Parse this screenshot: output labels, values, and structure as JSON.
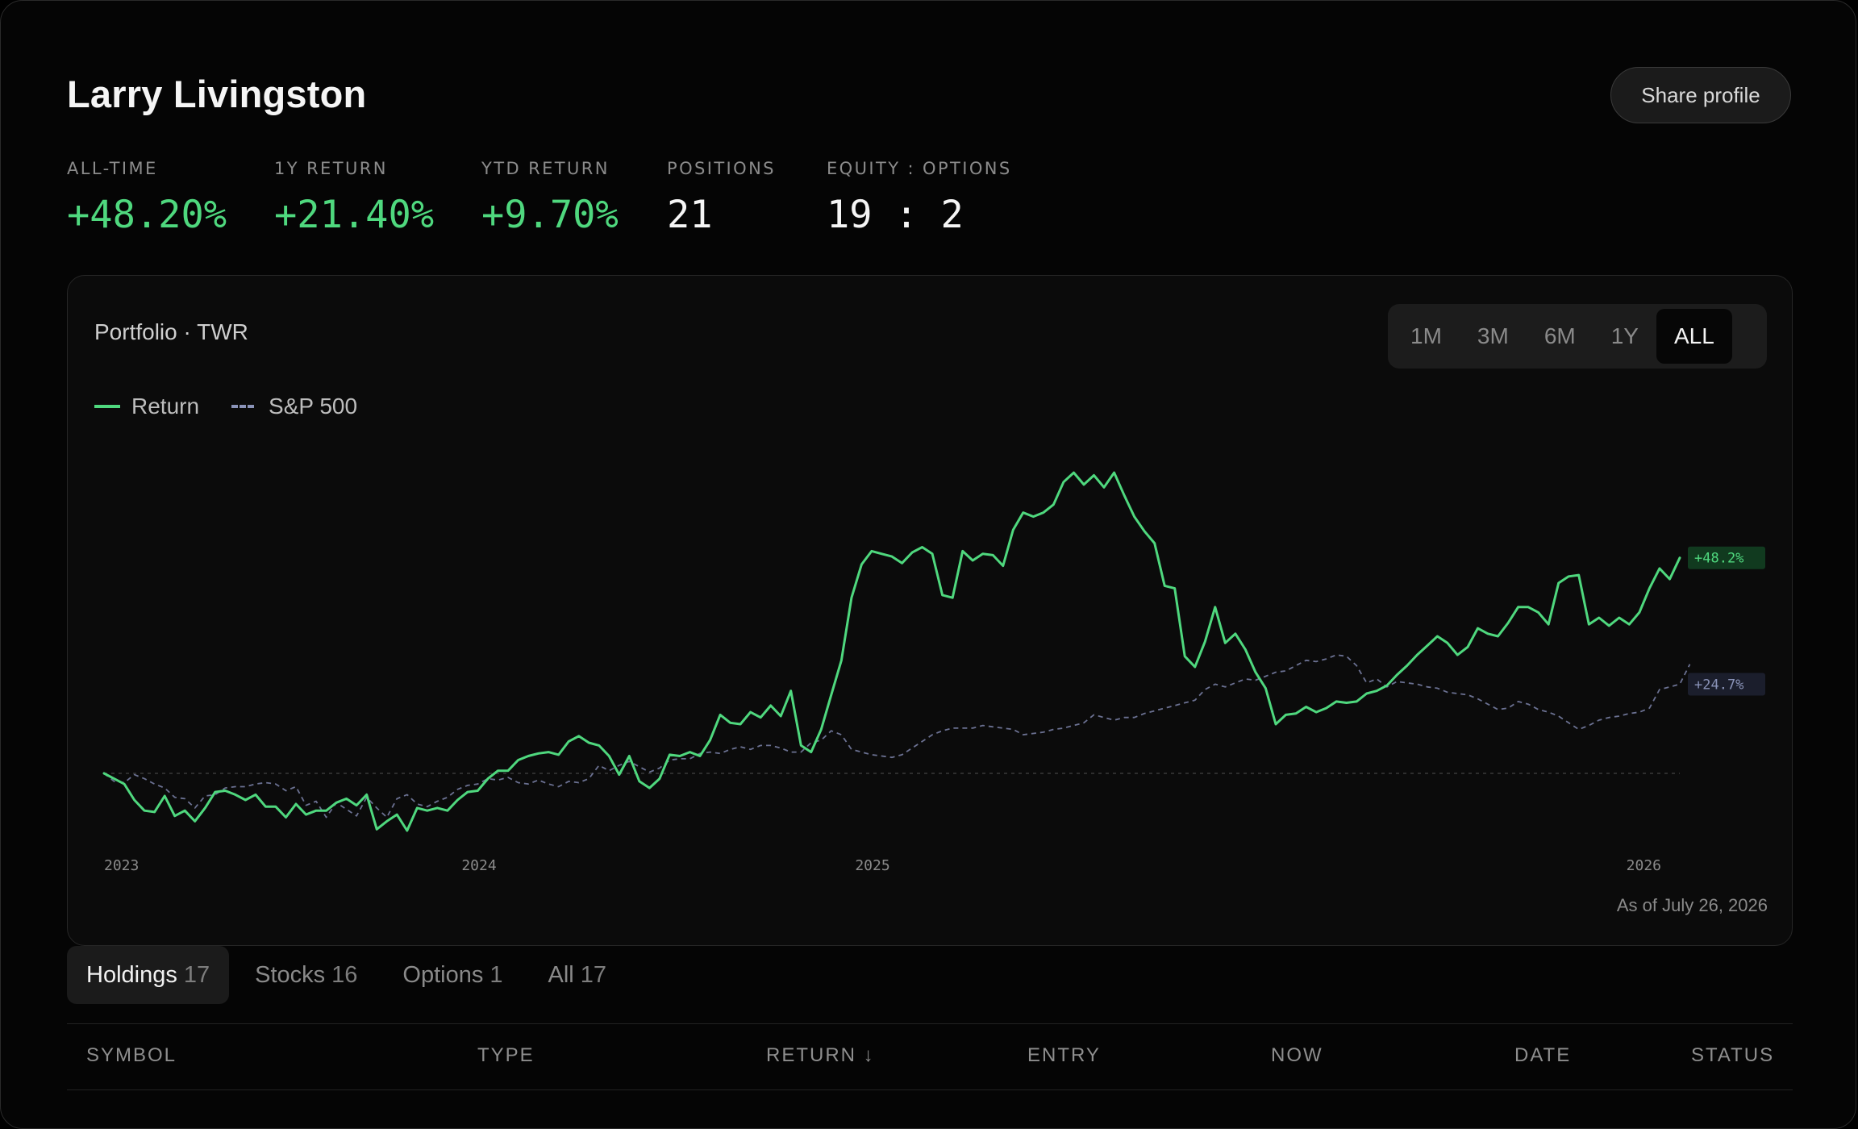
{
  "profile": {
    "name": "Larry Livingston",
    "share_label": "Share profile"
  },
  "stats": [
    {
      "label": "ALL-TIME",
      "value": "+48.20%",
      "tone": "positive"
    },
    {
      "label": "1Y RETURN",
      "value": "+21.40%",
      "tone": "positive"
    },
    {
      "label": "YTD RETURN",
      "value": "+9.70%",
      "tone": "positive"
    },
    {
      "label": "POSITIONS",
      "value": "21",
      "tone": "neutral"
    },
    {
      "label": "EQUITY : OPTIONS",
      "value": "19 : 2",
      "tone": "neutral"
    }
  ],
  "chart": {
    "title": "Portfolio · TWR",
    "ranges": [
      "1M",
      "3M",
      "6M",
      "1Y",
      "ALL"
    ],
    "active_range": "ALL",
    "as_of": "As of July 26, 2026"
  },
  "colors": {
    "positive": "#4fd87e",
    "benchmark": "#8a93b8",
    "background": "#050505",
    "card": "#0b0b0b"
  },
  "chart_data": {
    "type": "line",
    "x_ticks": [
      "2023",
      "2024",
      "2025",
      "2026"
    ],
    "ylim": [
      -5,
      35
    ],
    "baseline": 0,
    "grid": false,
    "legend_placement": "top-left",
    "series": [
      {
        "name": "Return",
        "color": "#4fd87e",
        "end_label": "+48.2%",
        "values": [
          0,
          -0.4,
          -0.8,
          -2,
          -2.8,
          -2.9,
          -1.7,
          -3.2,
          -2.8,
          -3.6,
          -2.6,
          -1.4,
          -1.3,
          -1.6,
          -2,
          -1.6,
          -2.5,
          -2.5,
          -3.3,
          -2.3,
          -3.1,
          -2.8,
          -2.8,
          -2.2,
          -1.9,
          -2.4,
          -1.6,
          -4.2,
          -3.6,
          -3.1,
          -4.3,
          -2.6,
          -2.8,
          -2.6,
          -2.8,
          -2,
          -1.4,
          -1.3,
          -0.4,
          0.2,
          0.2,
          1,
          1.3,
          1.5,
          1.6,
          1.4,
          2.4,
          2.8,
          2.3,
          2.1,
          1.3,
          -0.1,
          1.3,
          -0.6,
          -1.1,
          -0.4,
          1.4,
          1.3,
          1.6,
          1.3,
          2.5,
          4.4,
          3.8,
          3.7,
          4.6,
          4.2,
          5.1,
          4.3,
          6.2,
          2.1,
          1.6,
          3.3,
          5.9,
          8.5,
          13.2,
          15.7,
          16.7,
          16.5,
          16.3,
          15.8,
          16.6,
          17,
          16.5,
          13.4,
          13.2,
          16.7,
          16,
          16.5,
          16.4,
          15.6,
          18.3,
          19.6,
          19.3,
          19.6,
          20.2,
          21.9,
          22.6,
          21.7,
          22.4,
          21.5,
          22.6,
          20.9,
          19.3,
          18.2,
          17.3,
          14.1,
          13.9,
          8.8,
          8,
          9.9,
          12.5,
          9.8,
          10.5,
          9.3,
          7.6,
          6.4,
          3.7,
          4.4,
          4.5,
          5,
          4.6,
          4.9,
          5.4,
          5.3,
          5.4,
          6,
          6.2,
          6.6,
          7.4,
          8.1,
          8.9,
          9.6,
          10.3,
          9.8,
          8.9,
          9.5,
          10.9,
          10.5,
          10.3,
          11.3,
          12.5,
          12.5,
          12.1,
          11.2,
          14.3,
          14.8,
          14.9,
          11.2,
          11.7,
          11.1,
          11.7,
          11.2,
          12.1,
          13.9,
          15.4,
          14.6,
          16.2
        ]
      },
      {
        "name": "S&P 500",
        "color": "#8a93b8",
        "end_label": "+24.7%",
        "values": [
          0,
          -0.6,
          -0.7,
          -0.1,
          -0.4,
          -0.8,
          -1.1,
          -1.8,
          -1.9,
          -2.6,
          -1.7,
          -1.6,
          -1.1,
          -1,
          -1,
          -0.8,
          -0.7,
          -0.8,
          -1.3,
          -1,
          -2.4,
          -2.1,
          -3.3,
          -2.2,
          -2.7,
          -3.2,
          -1.8,
          -2.6,
          -3.3,
          -1.9,
          -1.6,
          -2.3,
          -2.5,
          -2.1,
          -1.8,
          -1.2,
          -0.9,
          -0.8,
          -0.4,
          -0.5,
          -0.3,
          -0.7,
          -0.8,
          -0.5,
          -0.8,
          -1,
          -0.6,
          -0.7,
          -0.4,
          0.6,
          0.2,
          0.6,
          0.9,
          0.5,
          0.1,
          0.4,
          1,
          1.1,
          1.1,
          1.5,
          1.6,
          1.5,
          1.8,
          2,
          1.8,
          2.1,
          2.1,
          1.9,
          1.6,
          1.6,
          2.3,
          2.5,
          3.2,
          2.9,
          1.8,
          1.6,
          1.4,
          1.3,
          1.2,
          1.4,
          1.9,
          2.4,
          2.9,
          3.2,
          3.4,
          3.4,
          3.4,
          3.6,
          3.5,
          3.4,
          3.3,
          2.9,
          3,
          3.1,
          3.3,
          3.4,
          3.6,
          3.8,
          4.4,
          4.2,
          4,
          4.2,
          4.2,
          4.5,
          4.7,
          4.9,
          5.1,
          5.3,
          5.5,
          6.3,
          6.7,
          6.5,
          6.8,
          7.1,
          7,
          7.3,
          7.6,
          7.7,
          8.1,
          8.5,
          8.4,
          8.6,
          8.9,
          8.8,
          8.1,
          6.8,
          7.1,
          6.5,
          6.9,
          6.8,
          6.7,
          6.5,
          6.4,
          6.1,
          6,
          5.9,
          5.6,
          5.2,
          4.8,
          4.9,
          5.4,
          5.2,
          4.8,
          4.6,
          4.3,
          3.8,
          3.3,
          3.6,
          4,
          4.2,
          4.3,
          4.5,
          4.6,
          4.9,
          6.3,
          6.5,
          6.7,
          8.2
        ]
      }
    ]
  },
  "tabs": [
    {
      "label": "Holdings",
      "count": "17",
      "active": true
    },
    {
      "label": "Stocks",
      "count": "16",
      "active": false
    },
    {
      "label": "Options",
      "count": "1",
      "active": false
    },
    {
      "label": "All",
      "count": "17",
      "active": false
    }
  ],
  "table": {
    "columns": [
      "SYMBOL",
      "TYPE",
      "RETURN ↓",
      "ENTRY",
      "NOW",
      "DATE",
      "STATUS"
    ]
  }
}
